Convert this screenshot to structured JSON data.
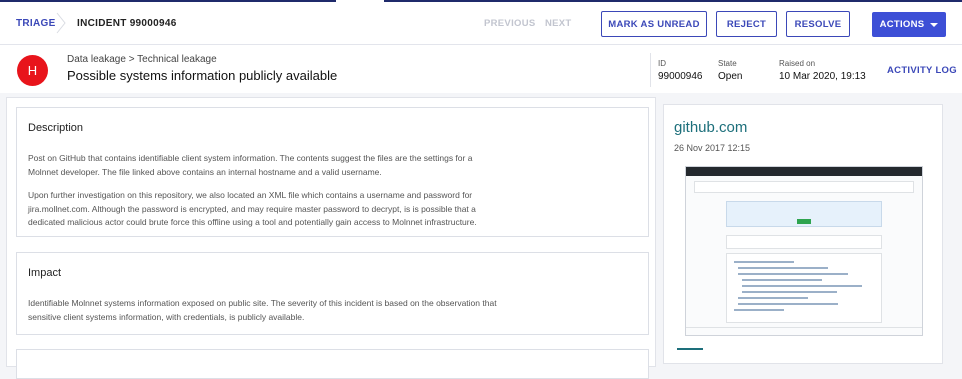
{
  "nav": {
    "breadcrumb_root": "TRIAGE",
    "breadcrumb_current": "INCIDENT 99000946",
    "previous_label": "PREVIOUS",
    "next_label": "NEXT",
    "mark_unread_label": "MARK AS UNREAD",
    "reject_label": "REJECT",
    "resolve_label": "RESOLVE",
    "actions_label": "ACTIONS"
  },
  "incident": {
    "avatar_letter": "H",
    "category": "Data leakage > Technical leakage",
    "title": "Possible systems information publicly available",
    "id_label": "ID",
    "id_value": "99000946",
    "state_label": "State",
    "state_value": "Open",
    "raised_label": "Raised on",
    "raised_value": "10 Mar 2020, 19:13",
    "activity_log_label": "ACTIVITY LOG",
    "severity_color": "#e8141b"
  },
  "description": {
    "title": "Description",
    "para1_line1": "Post on GitHub that contains identifiable client system information. The contents suggest the files are the settings for a",
    "para1_line2": "Molnnet developer. The file linked above contains an internal hostname and a valid username.",
    "para2_line1": "Upon further investigation on this repository, we also located an XML file which contains a username and password for",
    "para2_line2": "jira.mollnet.com. Although the password is encrypted, and may require master password to decrypt, is is possible that a",
    "para2_line3": "dedicated malicious actor could brute force this offline using a tool and potentially gain access to Molnnet infrastructure."
  },
  "impact": {
    "title": "Impact",
    "line1": "Identifiable Molnnet systems information exposed on public site. The severity of this incident is based on the observation that",
    "line2": "sensitive client systems information, with credentials, is publicly available."
  },
  "source": {
    "domain": "github.com",
    "date": "26 Nov 2017 12:15",
    "screenshot_icon": "github-page-thumbnail-icon",
    "link_color": "#1d6f7b"
  },
  "colors": {
    "accent": "#3b48b8",
    "primary_button": "#3d4fd6"
  }
}
